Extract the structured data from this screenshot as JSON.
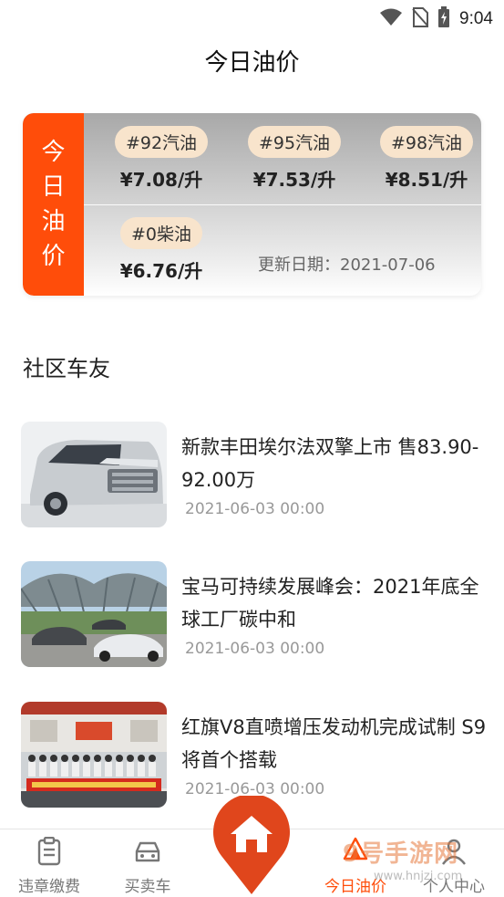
{
  "status_bar": {
    "time": "9:04"
  },
  "page": {
    "title": "今日油价"
  },
  "oil_card": {
    "side_label": [
      "今",
      "日",
      "油",
      "价"
    ],
    "prices": [
      {
        "fuel": "#92汽油",
        "price": "¥7.08/升"
      },
      {
        "fuel": "#95汽油",
        "price": "¥7.53/升"
      },
      {
        "fuel": "#98汽油",
        "price": "¥8.51/升"
      },
      {
        "fuel": "#0柴油",
        "price": "¥6.76/升"
      }
    ],
    "update_date": "更新日期：2021-07-06"
  },
  "community": {
    "title": "社区车友",
    "news": [
      {
        "title": "新款丰田埃尔法双擎上市 售83.90-92.00万",
        "date": "2021-06-03 00:00"
      },
      {
        "title": "宝马可持续发展峰会：2021年底全球工厂碳中和",
        "date": "2021-06-03 00:00"
      },
      {
        "title": "红旗V8直喷增压发动机完成试制 S9将首个搭载",
        "date": "2021-06-03 00:00"
      }
    ]
  },
  "bottom_nav": {
    "items": [
      {
        "label": "违章缴费",
        "icon": "clipboard-icon"
      },
      {
        "label": "买卖车",
        "icon": "car-icon"
      },
      {
        "label": "今日油价",
        "icon": "fire-icon"
      },
      {
        "label": "个人中心",
        "icon": "person-icon"
      }
    ],
    "center_icon": "home-icon"
  },
  "watermark": {
    "text": "9号手游网",
    "url": "www.hnjzj.com"
  },
  "colors": {
    "accent": "#ff4d0a",
    "tag_bg": "#f8e4cc"
  }
}
